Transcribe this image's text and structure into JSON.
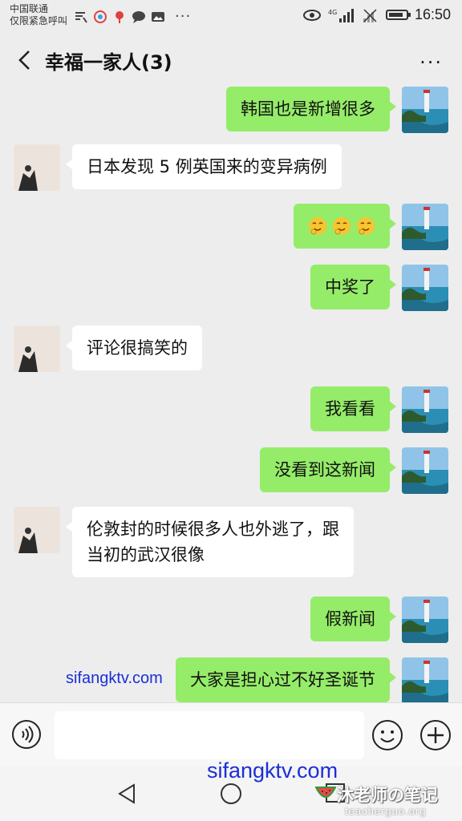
{
  "status_bar": {
    "carrier_line1": "中国联通",
    "carrier_line2": "仅限紧急呼叫",
    "more_glyph": "···",
    "network_label": "4G",
    "time": "16:50",
    "battery_level": 0.85
  },
  "header": {
    "back_icon": "chevron-left-icon",
    "title": "幸福一家人(3)",
    "more_icon": "more-dots-icon",
    "more_glyph": "···"
  },
  "messages": [
    {
      "sender": "me",
      "text": "韩国也是新增很多"
    },
    {
      "sender": "other",
      "text": "日本发现 5 例英国来的变异病例"
    },
    {
      "sender": "me",
      "type": "emoji",
      "emoji": [
        "smirk-emoji",
        "smirk-emoji",
        "smirk-emoji"
      ]
    },
    {
      "sender": "me",
      "text": "中奖了"
    },
    {
      "sender": "other",
      "text": "评论很搞笑的"
    },
    {
      "sender": "me",
      "text": "我看看"
    },
    {
      "sender": "me",
      "text": "没看到这新闻"
    },
    {
      "sender": "other",
      "text_line1": "伦敦封的时候很多人也外逃了，跟",
      "text_line2": "当初的武汉很像"
    },
    {
      "sender": "me",
      "text": "假新闻"
    },
    {
      "sender": "me",
      "text": "大家是担心过不好圣诞节"
    }
  ],
  "input_bar": {
    "voice_icon": "voice-icon",
    "input_value": "",
    "emoji_icon": "emoji-face-icon",
    "plus_icon": "plus-icon"
  },
  "watermarks": {
    "site1": "sifangktv.com",
    "site2": "sifangktv.com",
    "brand": "沐老师の笔记",
    "brand_url": "teacherguo.org"
  },
  "colors": {
    "bubble_me": "#95ec69",
    "bubble_other": "#ffffff",
    "background": "#ededed"
  }
}
